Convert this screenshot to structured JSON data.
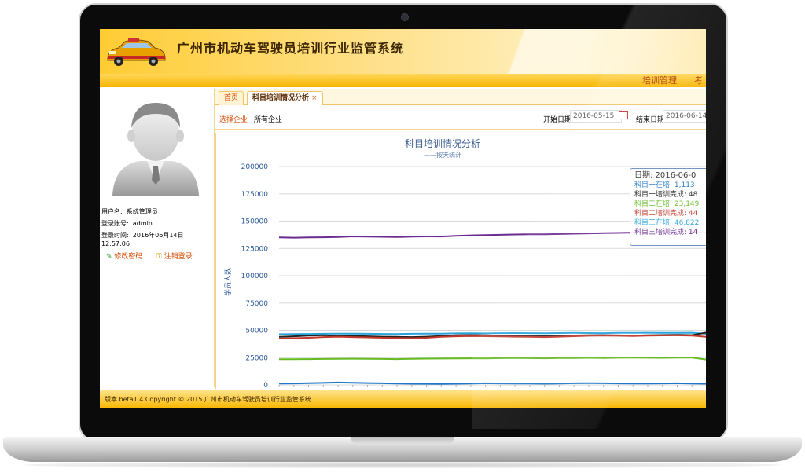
{
  "app": {
    "title": "广州市机动车驾驶员培训行业监管系统"
  },
  "nav": {
    "items": [
      "培训管理",
      "考"
    ]
  },
  "user": {
    "name_label": "用户名:",
    "name": "系统管理员",
    "account_label": "登录账号:",
    "account": "admin",
    "login_time_label": "登录时间:",
    "login_date": "2016年06月14日",
    "login_clock": "12:57:06",
    "change_password": "修改密码",
    "logout": "注销登录"
  },
  "tabs": [
    {
      "label": "首页",
      "closable": false
    },
    {
      "label": "科目培训情况分析",
      "closable": true,
      "close_glyph": "×"
    }
  ],
  "filters": {
    "enterprise_label": "选择企业",
    "enterprise_value": "所有企业",
    "start_label": "开始日期",
    "start_value": "2016-05-15",
    "end_label": "结束日期",
    "end_value": "2016-06-14"
  },
  "chart_data": {
    "type": "line",
    "title": "科目培训情况分析",
    "subtitle": "——按天统计",
    "ylabel": "学员人数",
    "xlabel": "",
    "ylim": [
      0,
      200000
    ],
    "yticks": [
      "200000",
      "175000",
      "150000",
      "125000",
      "100000",
      "75000",
      "50000",
      "25000",
      "0"
    ],
    "points": 30,
    "grid": true,
    "series": [
      {
        "color": "#6b2c91",
        "values": [
          135000,
          134800,
          135000,
          135200,
          135500,
          136000,
          135800,
          135600,
          135400,
          135800,
          136000,
          135900,
          136500,
          137000,
          137200,
          137500,
          137800,
          138000,
          137900,
          138200,
          138500,
          138800,
          139000,
          139200,
          139500,
          139800,
          139700,
          140000,
          140200,
          140000
        ]
      },
      {
        "color": "#29a3dc",
        "values": [
          46500,
          46600,
          46700,
          46800,
          46900,
          47000,
          46800,
          46700,
          46600,
          46800,
          47000,
          46900,
          47200,
          47300,
          47200,
          47400,
          47500,
          47400,
          47300,
          47500,
          47600,
          47500,
          47400,
          47600,
          47700,
          47800,
          47600,
          47700,
          47800,
          46822
        ]
      },
      {
        "color": "#222222",
        "values": [
          44000,
          44500,
          45200,
          45500,
          45000,
          44800,
          44500,
          44200,
          44000,
          43800,
          44200,
          44800,
          45500,
          45700,
          45500,
          45200,
          45000,
          44800,
          44600,
          45000,
          45300,
          45500,
          45600,
          45400,
          45200,
          45500,
          45700,
          45800,
          45600,
          48000
        ]
      },
      {
        "color": "#c0392b",
        "values": [
          42500,
          42800,
          43200,
          43800,
          44200,
          43800,
          43500,
          43200,
          43000,
          42800,
          43200,
          44000,
          44500,
          44800,
          44600,
          44400,
          44200,
          44000,
          43800,
          44200,
          44600,
          45000,
          45200,
          45000,
          44800,
          45100,
          45300,
          45400,
          45200,
          44000
        ]
      },
      {
        "color": "#66bb22",
        "values": [
          23500,
          23600,
          23700,
          23800,
          23900,
          24000,
          23900,
          23800,
          23700,
          23900,
          24100,
          24200,
          24300,
          24400,
          24300,
          24500,
          24600,
          24500,
          24400,
          24600,
          24700,
          24800,
          24700,
          24900,
          25000,
          24900,
          24800,
          25000,
          25100,
          23149
        ]
      },
      {
        "color": "#1f77c8",
        "values": [
          1200,
          1400,
          1600,
          1900,
          2200,
          2000,
          1700,
          1500,
          1300,
          1100,
          1000,
          900,
          1100,
          1300,
          1500,
          1400,
          1300,
          1200,
          1100,
          1300,
          1500,
          1600,
          1500,
          1400,
          1300,
          1200,
          1400,
          1500,
          1300,
          1113
        ]
      }
    ]
  },
  "tooltip": {
    "date_line": "日期: 2016-06-0",
    "rows": [
      {
        "text": "科目一在培: 1,113",
        "color": "#1f77c8"
      },
      {
        "text": "科目一培训完成: 48",
        "color": "#222222"
      },
      {
        "text": "科目二在培: 23,149",
        "color": "#66bb22"
      },
      {
        "text": "科目二培训完成: 44",
        "color": "#c0392b"
      },
      {
        "text": "科目三在培: 46,822",
        "color": "#29a3dc"
      },
      {
        "text": "科目三培训完成: 14",
        "color": "#6b2c91"
      }
    ]
  },
  "footer": {
    "text": "版本 beta1.4  Copyright © 2015 广州市机动车驾驶员培训行业监管系统"
  }
}
